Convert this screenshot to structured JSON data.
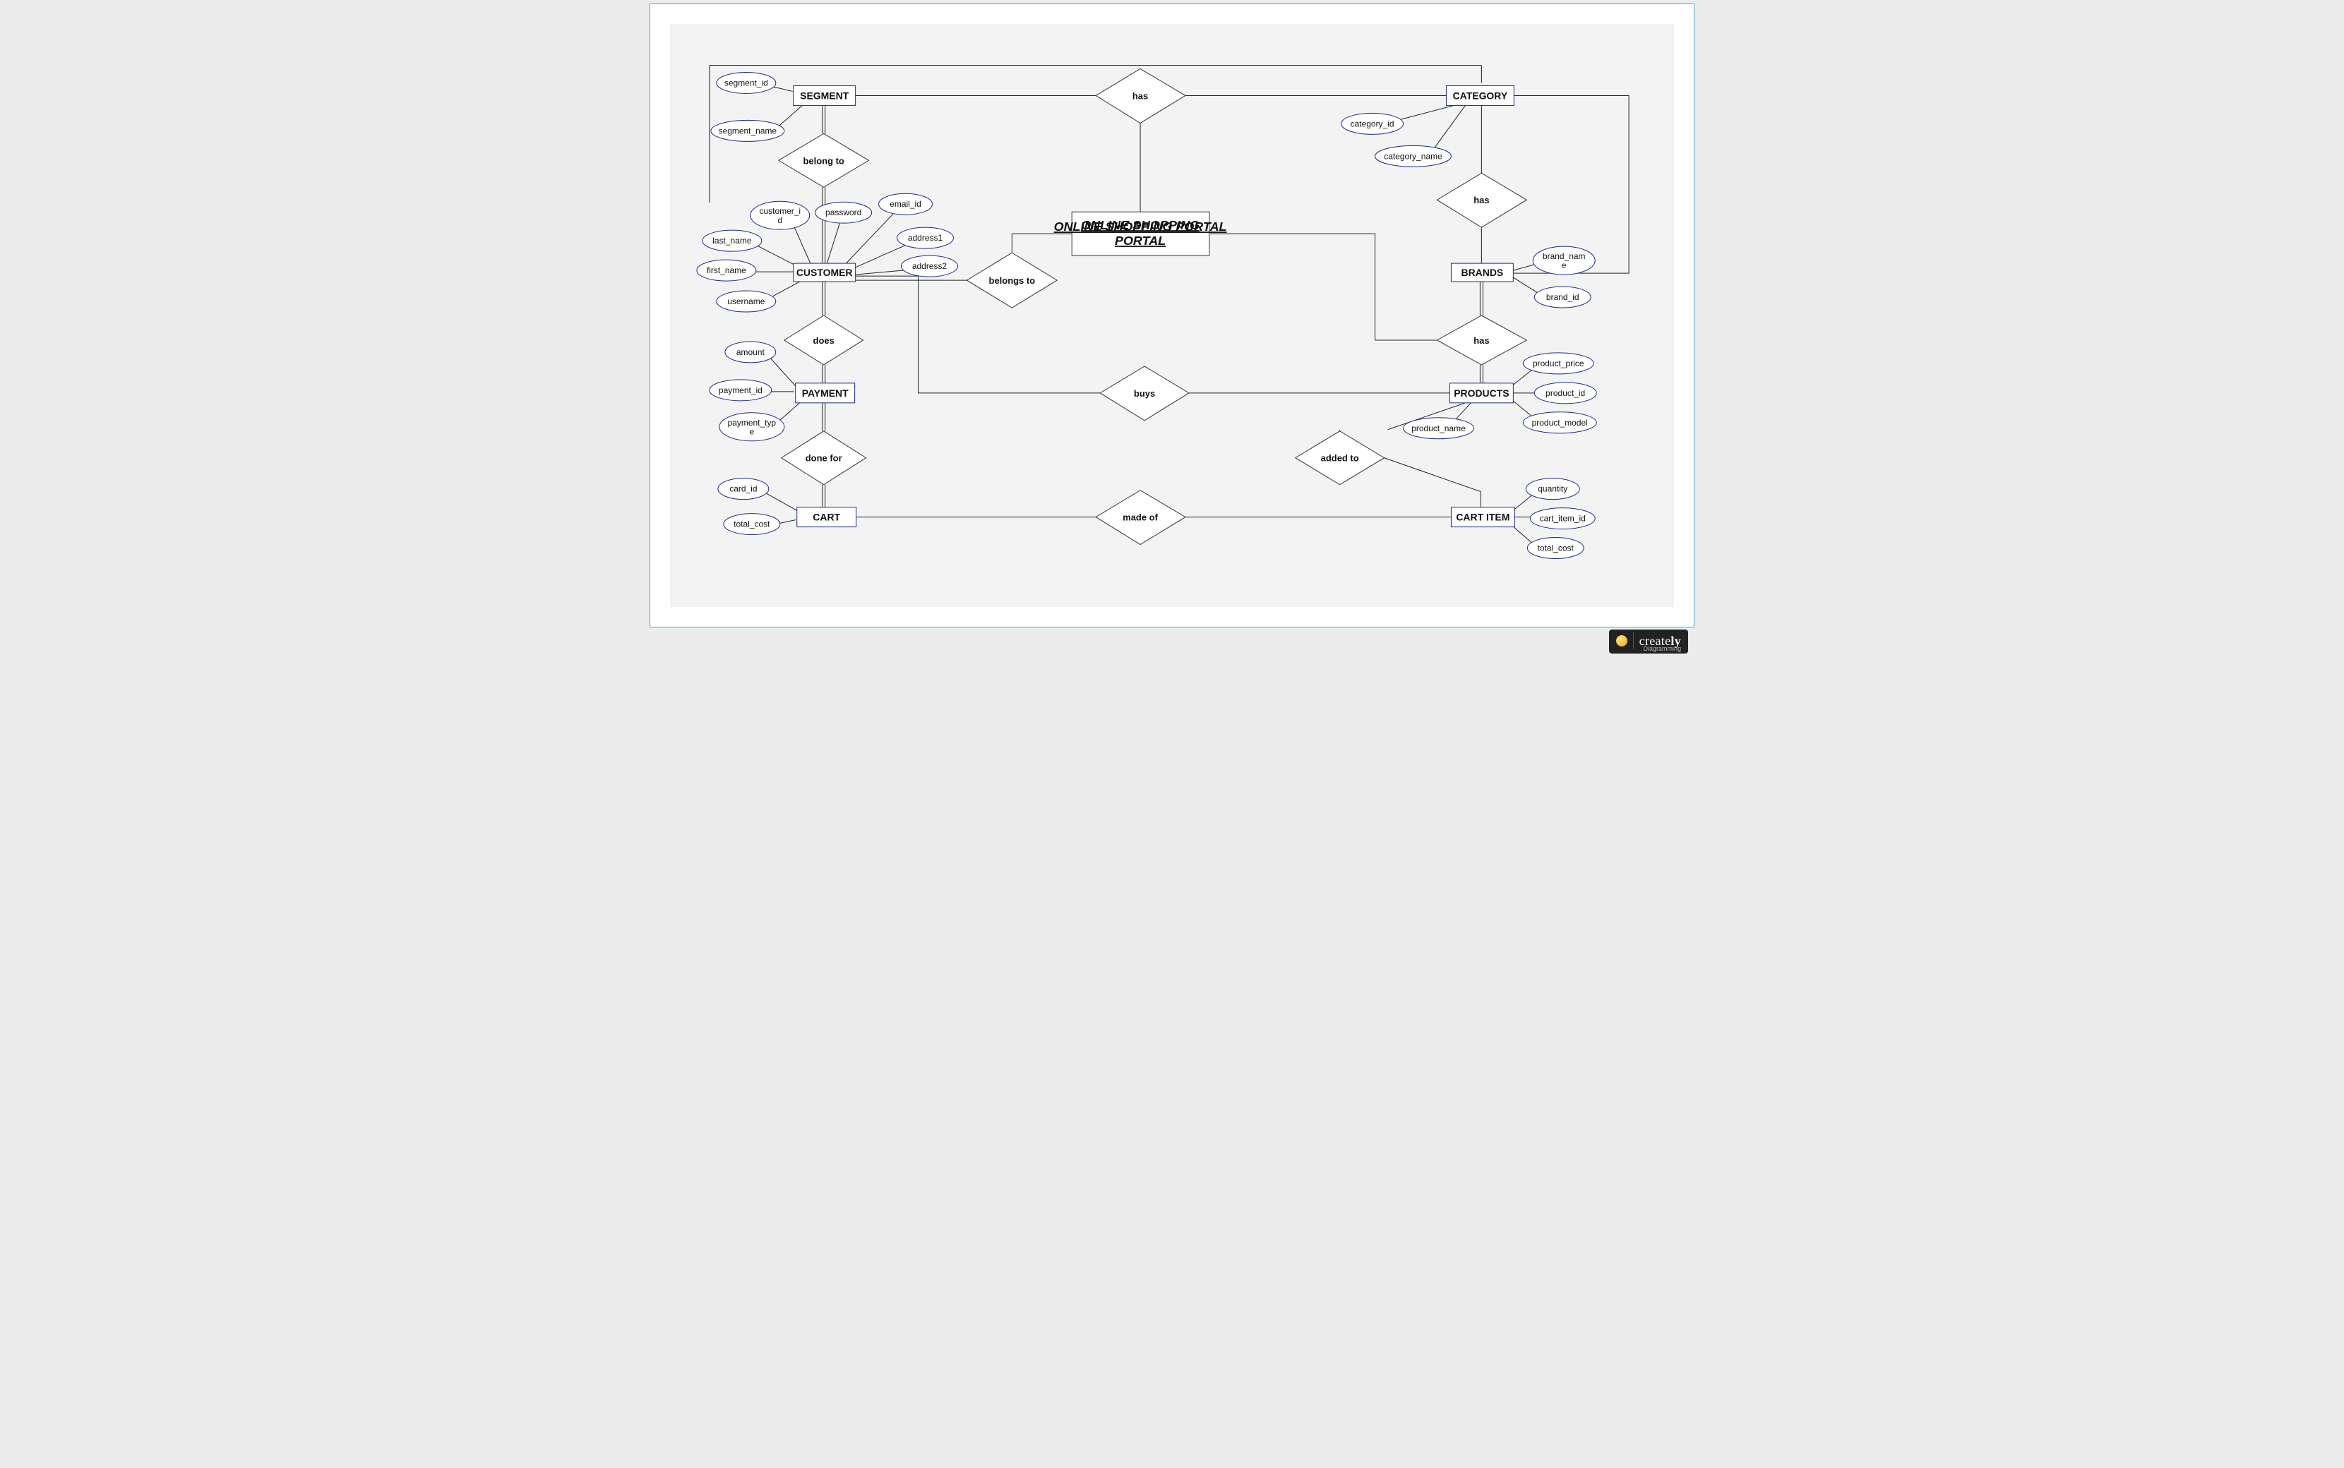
{
  "portal": {
    "title": "ONLINE SHOPPING PORTAL"
  },
  "entities": {
    "segment": "SEGMENT",
    "category": "CATEGORY",
    "customer": "CUSTOMER",
    "brands": "BRANDS",
    "payment": "PAYMENT",
    "products": "PRODUCTS",
    "cart": "CART",
    "cart_item": "CART ITEM"
  },
  "relationships": {
    "has_top": "has",
    "belong_to": "belong to",
    "has_cat_brand": "has",
    "belongs_to": "belongs to",
    "does": "does",
    "has_brand_prod": "has",
    "buys": "buys",
    "done_for": "done for",
    "added_to": "added to",
    "made_of": "made of"
  },
  "attributes": {
    "segment": {
      "segment_id": "segment_id",
      "segment_name": "segment_name"
    },
    "category": {
      "category_id": "category_id",
      "category_name": "category_name"
    },
    "customer": {
      "customer_id_1": "customer_i",
      "customer_id_2": "d",
      "password": "password",
      "email_id": "email_id",
      "last_name": "last_name",
      "address1": "address1",
      "first_name": "first_name",
      "address2": "address2",
      "username": "username"
    },
    "brands": {
      "brand_name_1": "brand_nam",
      "brand_name_2": "e",
      "brand_id": "brand_id"
    },
    "payment": {
      "amount": "amount",
      "payment_id": "payment_id",
      "payment_type_1": "payment_typ",
      "payment_type_2": "e"
    },
    "products": {
      "product_price": "product_price",
      "product_id": "product_id",
      "product_model": "product_model",
      "product_name": "product_name"
    },
    "cart": {
      "card_id": "card_id",
      "total_cost": "total_cost"
    },
    "cart_item": {
      "quantity": "quantity",
      "cart_item_id": "cart_item_id",
      "total_cost": "total_cost"
    }
  },
  "branding": {
    "name_1": "create",
    "name_2": "ly",
    "sub": "Diagramming"
  }
}
